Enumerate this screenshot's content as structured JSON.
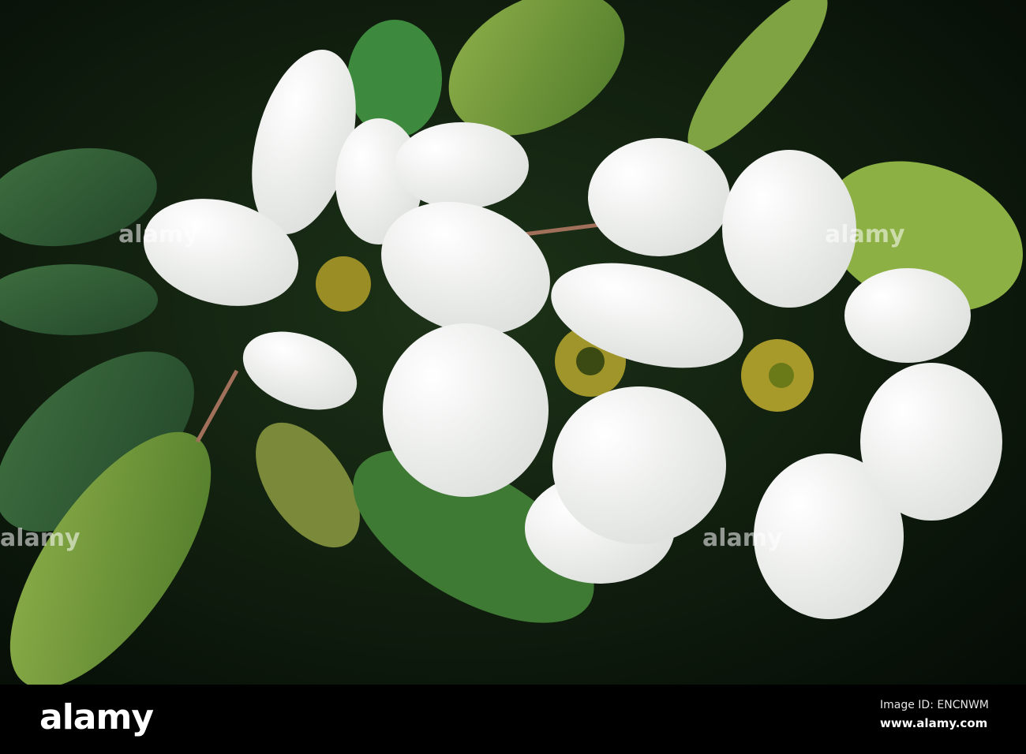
{
  "photo": {
    "subject": "white pearlbush flowers with green leaves",
    "colors": {
      "background": "#0b1a0c",
      "leaf": "#6f9a35",
      "leaf_dark": "#2f5a2c",
      "petal": "#f4f4f2",
      "center": "#a89a2a"
    }
  },
  "watermark": {
    "text": "alamy"
  },
  "footer": {
    "logo": "alamy",
    "image_id": "Image ID: ENCNWM",
    "url": "www.alamy.com"
  }
}
